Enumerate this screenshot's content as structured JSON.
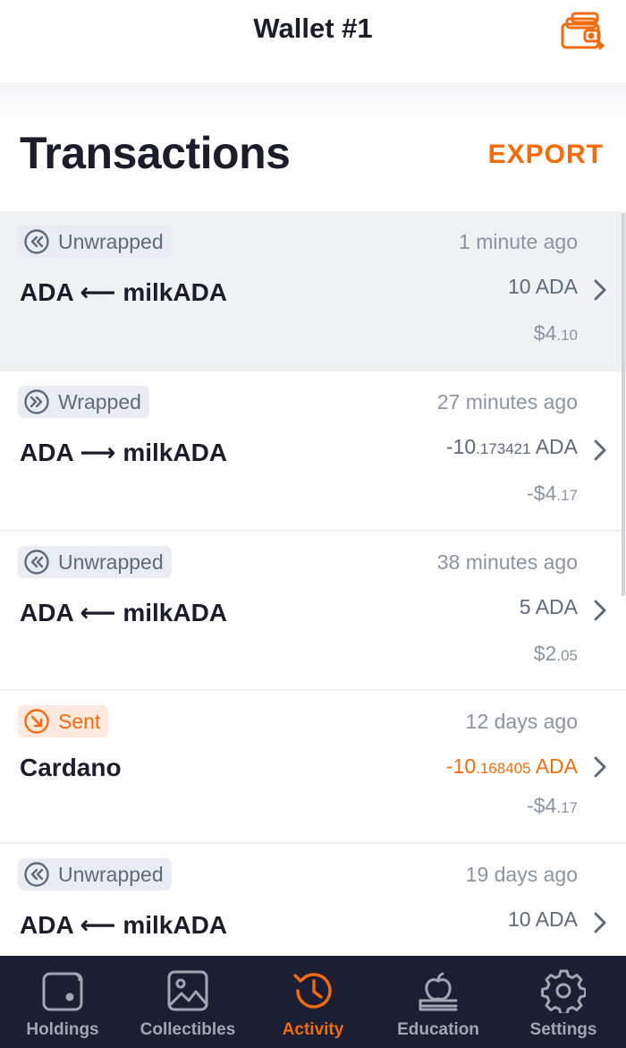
{
  "header": {
    "title": "Wallet #1",
    "wallet_icon": "wallets-switch-icon"
  },
  "page": {
    "title": "Transactions",
    "export_label": "EXPORT"
  },
  "colors": {
    "accent": "#f26c0d",
    "text_dark": "#1b1d2b",
    "text_muted": "#8a94a3",
    "nav_bg": "#1c1e33",
    "selected_row_bg": "#f0f1f2"
  },
  "transactions": [
    {
      "type": "Unwrapped",
      "icon": "double-chevron-left-circle-icon",
      "time": "1 minute ago",
      "title": "ADA ⟵ milkADA",
      "amount_main": "10",
      "amount_small": "",
      "amount_unit": " ADA",
      "fiat_main": "$4",
      "fiat_small": ".10"
    },
    {
      "type": "Wrapped",
      "icon": "double-chevron-right-circle-icon",
      "time": "27 minutes ago",
      "title": "ADA ⟶ milkADA",
      "amount_main": "-10",
      "amount_small": ".173421",
      "amount_unit": " ADA",
      "fiat_main": "-$4",
      "fiat_small": ".17"
    },
    {
      "type": "Unwrapped",
      "icon": "double-chevron-left-circle-icon",
      "time": "38 minutes ago",
      "title": "ADA ⟵ milkADA",
      "amount_main": "5",
      "amount_small": "",
      "amount_unit": " ADA",
      "fiat_main": "$2",
      "fiat_small": ".05"
    },
    {
      "type": "Sent",
      "icon": "arrow-down-right-circle-icon",
      "time": "12 days ago",
      "title": "Cardano",
      "amount_main": "-10",
      "amount_small": ".168405",
      "amount_unit": " ADA",
      "fiat_main": "-$4",
      "fiat_small": ".17"
    },
    {
      "type": "Unwrapped",
      "icon": "double-chevron-left-circle-icon",
      "time": "19 days ago",
      "title": "ADA ⟵ milkADA",
      "amount_main": "10",
      "amount_small": "",
      "amount_unit": " ADA",
      "fiat_main": "",
      "fiat_small": ""
    }
  ],
  "nav": [
    {
      "label": "Holdings",
      "icon": "wallet-icon"
    },
    {
      "label": "Collectibles",
      "icon": "image-icon"
    },
    {
      "label": "Activity",
      "icon": "history-icon",
      "active": true
    },
    {
      "label": "Education",
      "icon": "apple-books-icon"
    },
    {
      "label": "Settings",
      "icon": "gear-icon"
    }
  ]
}
